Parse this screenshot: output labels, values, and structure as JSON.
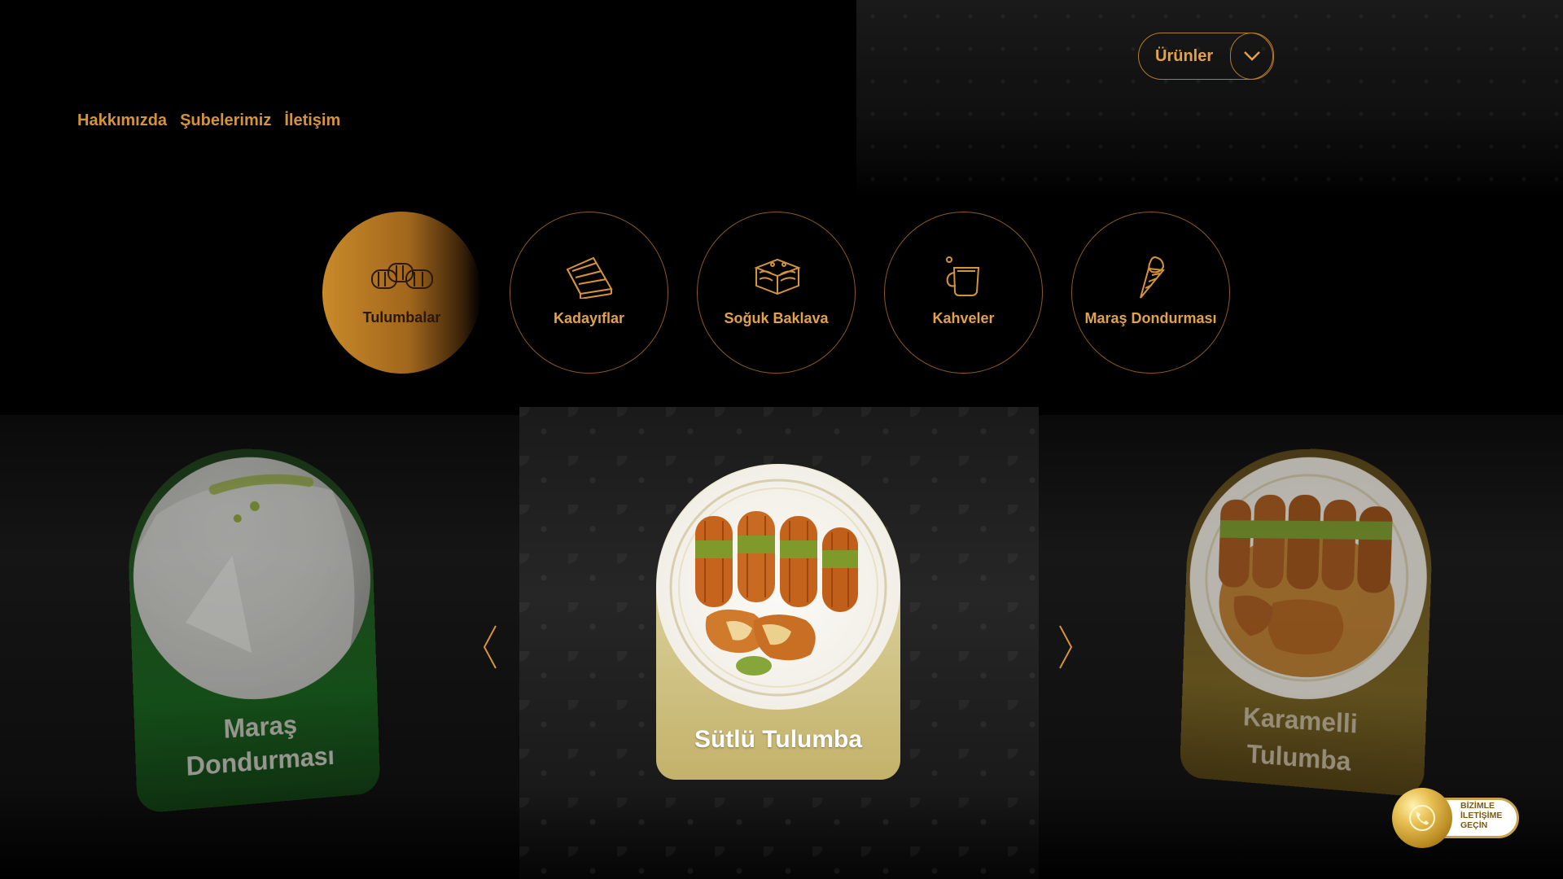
{
  "nav": {
    "items": [
      "Hakkımızda",
      "Şubelerimiz",
      "İletişim"
    ]
  },
  "products_dropdown": {
    "label": "Ürünler"
  },
  "categories": [
    {
      "label": "Tulumbalar",
      "icon": "tulumba-icon",
      "active": true
    },
    {
      "label": "Kadayıflar",
      "icon": "kadayif-slice-icon",
      "active": false
    },
    {
      "label": "Soğuk Baklava",
      "icon": "baklava-icon",
      "active": false
    },
    {
      "label": "Kahveler",
      "icon": "coffee-cup-icon",
      "active": false
    },
    {
      "label": "Maraş Dondurması",
      "icon": "ice-cream-cone-icon",
      "active": false
    }
  ],
  "carousel": {
    "prev": {
      "title_line1": "Maraş",
      "title_line2": "Dondurması",
      "color": "#1c5a1a"
    },
    "current": {
      "title": "Sütlü Tulumba",
      "color": "#d8cc94"
    },
    "next": {
      "title_line1": "Karamelli",
      "title_line2": "Tulumba",
      "color": "#715a1e"
    }
  },
  "contact_button": {
    "text": "BİZİMLE\nİLETİŞİME\nGEÇİN"
  },
  "colors": {
    "accent": "#d4943a",
    "background": "#000000"
  }
}
